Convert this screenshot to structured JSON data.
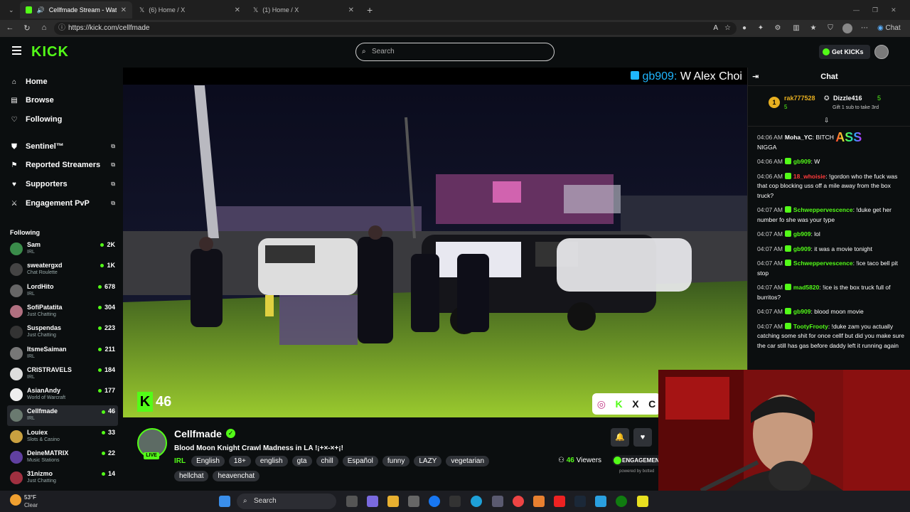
{
  "browser": {
    "tabs": [
      {
        "title": "Cellfmade Stream - Watch Liv",
        "icon": "kick-icon",
        "active": true
      },
      {
        "title": "(6) Home / X",
        "icon": "x-icon",
        "active": false
      },
      {
        "title": "(1) Home / X",
        "icon": "x-icon",
        "active": false
      }
    ],
    "new_tab": "+",
    "url": "https://kick.com/cellfmade",
    "copilot_label": "Chat"
  },
  "header": {
    "logo": "KICK",
    "search_placeholder": "Search",
    "get_kicks": "Get KICKs"
  },
  "sidebar": {
    "nav": [
      {
        "label": "Home",
        "icon": "home-icon"
      },
      {
        "label": "Browse",
        "icon": "browse-icon"
      },
      {
        "label": "Following",
        "icon": "heart-icon"
      }
    ],
    "tools": [
      {
        "label": "Sentinel™",
        "icon": "shield-icon"
      },
      {
        "label": "Reported Streamers",
        "icon": "flag-icon"
      },
      {
        "label": "Supporters",
        "icon": "heart-icon"
      },
      {
        "label": "Engagement PvP",
        "icon": "sword-icon"
      }
    ],
    "following_header": "Following",
    "following": [
      {
        "name": "Sam",
        "category": "IRL",
        "viewers": "2K",
        "color": "#3a8c4a"
      },
      {
        "name": "sweatergxd",
        "category": "Chat Roulette",
        "viewers": "1K",
        "color": "#444"
      },
      {
        "name": "LordHito",
        "category": "IRL",
        "viewers": "678",
        "color": "#666"
      },
      {
        "name": "SofiPatatita",
        "category": "Just Chatting",
        "viewers": "304",
        "color": "#b07080"
      },
      {
        "name": "Suspendas",
        "category": "Just Chatting",
        "viewers": "223",
        "color": "#333"
      },
      {
        "name": "ItsmeSaiman",
        "category": "IRL",
        "viewers": "211",
        "color": "#777"
      },
      {
        "name": "CRISTRAVELS",
        "category": "IRL",
        "viewers": "184",
        "color": "#ddd"
      },
      {
        "name": "AsianAndy",
        "category": "World of Warcraft",
        "viewers": "177",
        "color": "#eee"
      },
      {
        "name": "Cellfmade",
        "category": "IRL",
        "viewers": "46",
        "color": "#6a7a70"
      },
      {
        "name": "Louiex",
        "category": "Slots & Casino",
        "viewers": "33",
        "color": "#c9a040"
      },
      {
        "name": "DeineMATRIX",
        "category": "Music Stations",
        "viewers": "22",
        "color": "#6040a0"
      },
      {
        "name": "31nizmo",
        "category": "Just Chatting",
        "viewers": "14",
        "color": "#a03040"
      }
    ]
  },
  "video": {
    "overlay_user": "gb909:",
    "overlay_text": " W Alex Choi",
    "viewer_badge": "46"
  },
  "stream": {
    "channel": "Cellfmade",
    "live": "LIVE",
    "title": "Blood Moon Knight Crawl Madness in LA !¡+×-×+¡!",
    "category": "IRL",
    "tags": [
      "English",
      "18+",
      "english",
      "gta",
      "chill",
      "Español",
      "funny",
      "LAZY",
      "vegetarian",
      "hellchat",
      "heavenchat"
    ],
    "viewers_count": "46",
    "viewers_label": "Viewers",
    "engagement": "ENGAGEMENT",
    "powered_by": "powered by botted"
  },
  "chat": {
    "title": "Chat",
    "pinned": {
      "top_user": "rak777528",
      "top_count": "5",
      "second_user": "Dizzle416",
      "second_count": "5",
      "gift_note": "Gift 1 sub to take 3rd",
      "rank": "1"
    },
    "messages": [
      {
        "time": "04:06 AM",
        "user": "Moha_YC",
        "color": "#ffffff",
        "text": "BITCH ",
        "emote": "ASS",
        "tail": "NIGGA"
      },
      {
        "time": "04:06 AM",
        "user": "gb909",
        "color": "#53fc18",
        "text": "W"
      },
      {
        "time": "04:06 AM",
        "user": "18_whoisie",
        "color": "#ff3b3b",
        "text": "!gordon who the fuck was that cop blocking uss off a mile away from the box truck?"
      },
      {
        "time": "04:07 AM",
        "user": "Schweppervescence",
        "color": "#53fc18",
        "text": "!duke get her number fo she was your type"
      },
      {
        "time": "04:07 AM",
        "user": "gb909",
        "color": "#53fc18",
        "text": "lol"
      },
      {
        "time": "04:07 AM",
        "user": "gb909",
        "color": "#53fc18",
        "text": "it was a movie tonight"
      },
      {
        "time": "04:07 AM",
        "user": "Schweppervescence",
        "color": "#53fc18",
        "text": "!ice taco bell pit stop"
      },
      {
        "time": "04:07 AM",
        "user": "mad5820",
        "color": "#53fc18",
        "text": "!ice is the box truck full of burritos?"
      },
      {
        "time": "04:07 AM",
        "user": "gb909",
        "color": "#53fc18",
        "text": "blood moon movie"
      },
      {
        "time": "04:07 AM",
        "user": "TootyFrooty",
        "color": "#53fc18",
        "text": "!duke zam you actually catching some shit for once cellf but did you make sure the car still has gas before daddy left it running again"
      }
    ]
  },
  "taskbar": {
    "weather_temp": "53°F",
    "weather_desc": "Clear",
    "search": "Search"
  },
  "colors": {
    "accent": "#53fc18",
    "bg": "#0b0e0f",
    "panel": "#24272c"
  }
}
